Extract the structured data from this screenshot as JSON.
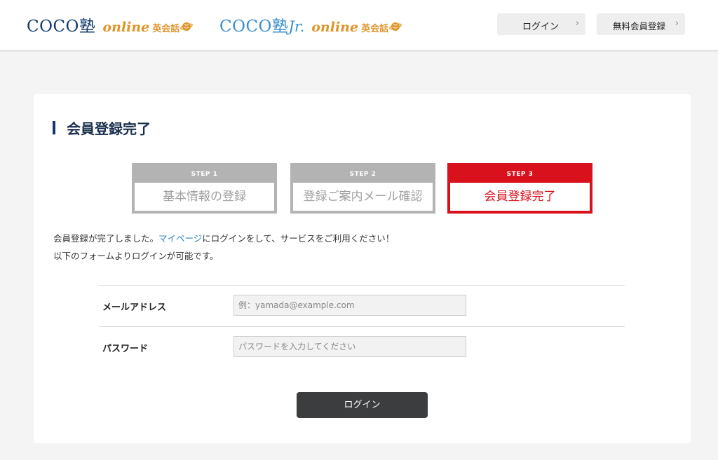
{
  "header": {
    "logo1": {
      "main": "COCO塾",
      "online": "online",
      "eikaiwa": "英会話"
    },
    "logo2": {
      "main": "COCO塾",
      "jr": "Jr.",
      "online": "online",
      "eikaiwa": "英会話"
    },
    "login_button": "ログイン",
    "register_button": "無料会員登録",
    "chevron": "›"
  },
  "main": {
    "title": "会員登録完了",
    "steps": [
      {
        "label": "STEP 1",
        "name": "基本情報の登録"
      },
      {
        "label": "STEP 2",
        "name": "登録ご案内メール確認"
      },
      {
        "label": "STEP 3",
        "name": "会員登録完了"
      }
    ],
    "active_step": 3,
    "message": {
      "before_link": "会員登録が完了しました。",
      "link": "マイページ",
      "after_link": "にログインをして、サービスをご利用ください！",
      "line2": "以下のフォームよりログインが可能です。"
    },
    "form": {
      "email_label": "メールアドレス",
      "email_placeholder": "例：yamada@example.com",
      "password_label": "パスワード",
      "password_placeholder": "パスワードを入力してください",
      "submit_label": "ログイン"
    }
  },
  "colors": {
    "navy": "#123a6e",
    "blue": "#3a8ed0",
    "orange": "#e0952a",
    "active_red": "#d9111c",
    "inactive_gray": "#b3b3b3",
    "button_dark": "#3c3d3f"
  }
}
